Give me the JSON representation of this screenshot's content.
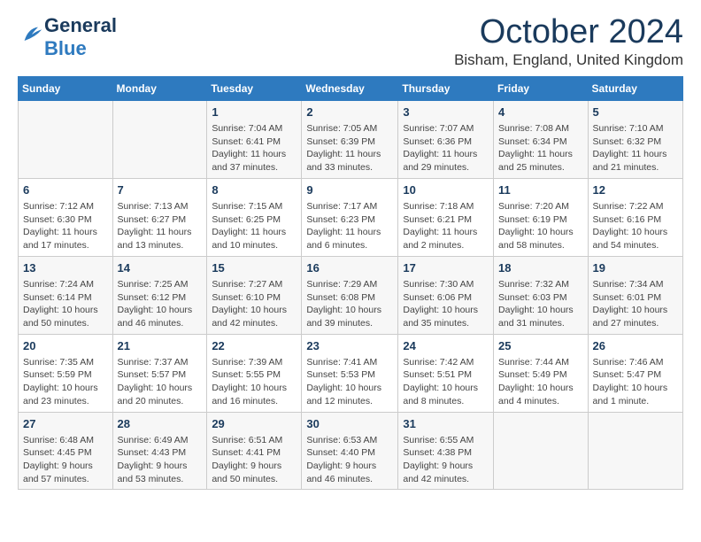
{
  "logo": {
    "general": "General",
    "blue": "Blue"
  },
  "title": {
    "month": "October 2024",
    "location": "Bisham, England, United Kingdom"
  },
  "headers": [
    "Sunday",
    "Monday",
    "Tuesday",
    "Wednesday",
    "Thursday",
    "Friday",
    "Saturday"
  ],
  "weeks": [
    [
      {
        "day": "",
        "info": ""
      },
      {
        "day": "",
        "info": ""
      },
      {
        "day": "1",
        "info": "Sunrise: 7:04 AM\nSunset: 6:41 PM\nDaylight: 11 hours and 37 minutes."
      },
      {
        "day": "2",
        "info": "Sunrise: 7:05 AM\nSunset: 6:39 PM\nDaylight: 11 hours and 33 minutes."
      },
      {
        "day": "3",
        "info": "Sunrise: 7:07 AM\nSunset: 6:36 PM\nDaylight: 11 hours and 29 minutes."
      },
      {
        "day": "4",
        "info": "Sunrise: 7:08 AM\nSunset: 6:34 PM\nDaylight: 11 hours and 25 minutes."
      },
      {
        "day": "5",
        "info": "Sunrise: 7:10 AM\nSunset: 6:32 PM\nDaylight: 11 hours and 21 minutes."
      }
    ],
    [
      {
        "day": "6",
        "info": "Sunrise: 7:12 AM\nSunset: 6:30 PM\nDaylight: 11 hours and 17 minutes."
      },
      {
        "day": "7",
        "info": "Sunrise: 7:13 AM\nSunset: 6:27 PM\nDaylight: 11 hours and 13 minutes."
      },
      {
        "day": "8",
        "info": "Sunrise: 7:15 AM\nSunset: 6:25 PM\nDaylight: 11 hours and 10 minutes."
      },
      {
        "day": "9",
        "info": "Sunrise: 7:17 AM\nSunset: 6:23 PM\nDaylight: 11 hours and 6 minutes."
      },
      {
        "day": "10",
        "info": "Sunrise: 7:18 AM\nSunset: 6:21 PM\nDaylight: 11 hours and 2 minutes."
      },
      {
        "day": "11",
        "info": "Sunrise: 7:20 AM\nSunset: 6:19 PM\nDaylight: 10 hours and 58 minutes."
      },
      {
        "day": "12",
        "info": "Sunrise: 7:22 AM\nSunset: 6:16 PM\nDaylight: 10 hours and 54 minutes."
      }
    ],
    [
      {
        "day": "13",
        "info": "Sunrise: 7:24 AM\nSunset: 6:14 PM\nDaylight: 10 hours and 50 minutes."
      },
      {
        "day": "14",
        "info": "Sunrise: 7:25 AM\nSunset: 6:12 PM\nDaylight: 10 hours and 46 minutes."
      },
      {
        "day": "15",
        "info": "Sunrise: 7:27 AM\nSunset: 6:10 PM\nDaylight: 10 hours and 42 minutes."
      },
      {
        "day": "16",
        "info": "Sunrise: 7:29 AM\nSunset: 6:08 PM\nDaylight: 10 hours and 39 minutes."
      },
      {
        "day": "17",
        "info": "Sunrise: 7:30 AM\nSunset: 6:06 PM\nDaylight: 10 hours and 35 minutes."
      },
      {
        "day": "18",
        "info": "Sunrise: 7:32 AM\nSunset: 6:03 PM\nDaylight: 10 hours and 31 minutes."
      },
      {
        "day": "19",
        "info": "Sunrise: 7:34 AM\nSunset: 6:01 PM\nDaylight: 10 hours and 27 minutes."
      }
    ],
    [
      {
        "day": "20",
        "info": "Sunrise: 7:35 AM\nSunset: 5:59 PM\nDaylight: 10 hours and 23 minutes."
      },
      {
        "day": "21",
        "info": "Sunrise: 7:37 AM\nSunset: 5:57 PM\nDaylight: 10 hours and 20 minutes."
      },
      {
        "day": "22",
        "info": "Sunrise: 7:39 AM\nSunset: 5:55 PM\nDaylight: 10 hours and 16 minutes."
      },
      {
        "day": "23",
        "info": "Sunrise: 7:41 AM\nSunset: 5:53 PM\nDaylight: 10 hours and 12 minutes."
      },
      {
        "day": "24",
        "info": "Sunrise: 7:42 AM\nSunset: 5:51 PM\nDaylight: 10 hours and 8 minutes."
      },
      {
        "day": "25",
        "info": "Sunrise: 7:44 AM\nSunset: 5:49 PM\nDaylight: 10 hours and 4 minutes."
      },
      {
        "day": "26",
        "info": "Sunrise: 7:46 AM\nSunset: 5:47 PM\nDaylight: 10 hours and 1 minute."
      }
    ],
    [
      {
        "day": "27",
        "info": "Sunrise: 6:48 AM\nSunset: 4:45 PM\nDaylight: 9 hours and 57 minutes."
      },
      {
        "day": "28",
        "info": "Sunrise: 6:49 AM\nSunset: 4:43 PM\nDaylight: 9 hours and 53 minutes."
      },
      {
        "day": "29",
        "info": "Sunrise: 6:51 AM\nSunset: 4:41 PM\nDaylight: 9 hours and 50 minutes."
      },
      {
        "day": "30",
        "info": "Sunrise: 6:53 AM\nSunset: 4:40 PM\nDaylight: 9 hours and 46 minutes."
      },
      {
        "day": "31",
        "info": "Sunrise: 6:55 AM\nSunset: 4:38 PM\nDaylight: 9 hours and 42 minutes."
      },
      {
        "day": "",
        "info": ""
      },
      {
        "day": "",
        "info": ""
      }
    ]
  ]
}
